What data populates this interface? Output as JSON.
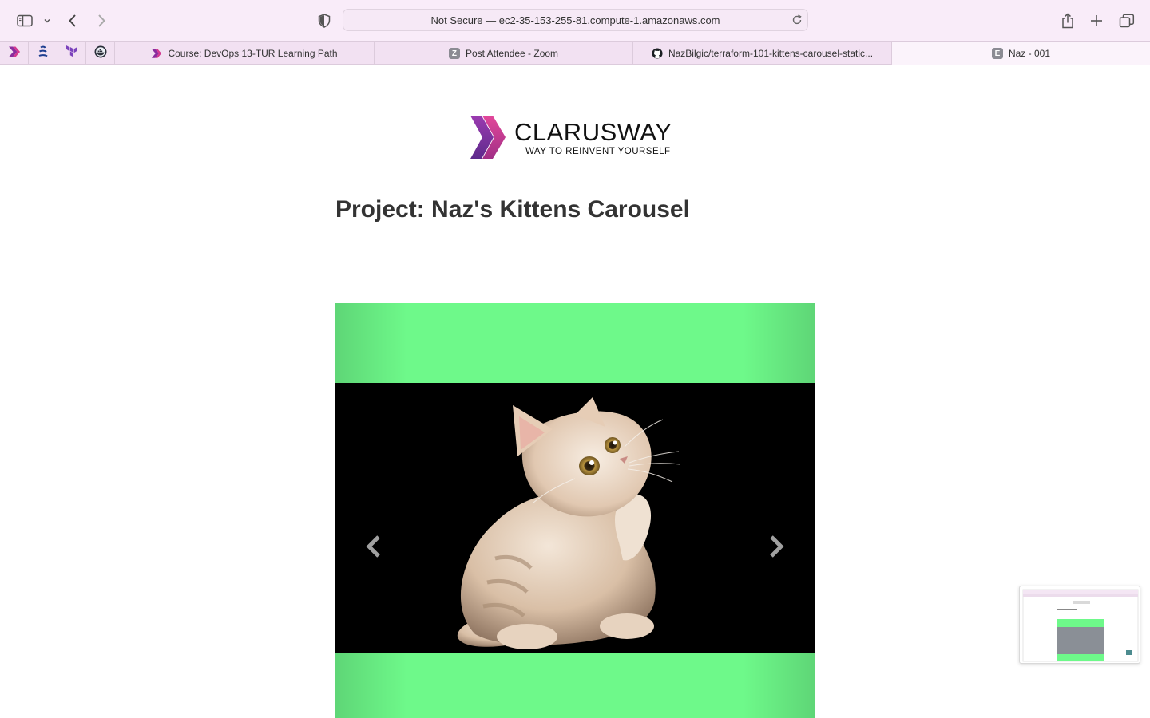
{
  "browser": {
    "url": "Not Secure — ec2-35-153-255-81.compute-1.amazonaws.com",
    "pinned_tabs": [
      "clarusway-icon",
      "stack-icon",
      "terraform-icon",
      "docker-icon"
    ],
    "tabs": [
      {
        "label": "Course: DevOps 13-TUR Learning Path",
        "icon": "clarusway-icon",
        "active": false
      },
      {
        "label": "Post Attendee - Zoom",
        "icon": "zoom-icon",
        "fav_letter": "Z",
        "active": false
      },
      {
        "label": "NazBilgic/terraform-101-kittens-carousel-static...",
        "icon": "github-icon",
        "active": false
      },
      {
        "label": "Naz - 001",
        "icon": "e-icon",
        "fav_letter": "E",
        "active": true
      }
    ]
  },
  "page": {
    "logo_word": "CLARUSWAY",
    "logo_tagline": "WAY TO REINVENT YOURSELF",
    "title": "Project: Naz's Kittens Carousel",
    "carousel": {
      "slide_image": "kitten-image",
      "background": "#6ef98a"
    }
  },
  "colors": {
    "chrome": "#f9ecf9",
    "tabbar": "#f2e1f2",
    "brand_purple": "#8a2d9e",
    "brand_pink": "#d3388f"
  }
}
